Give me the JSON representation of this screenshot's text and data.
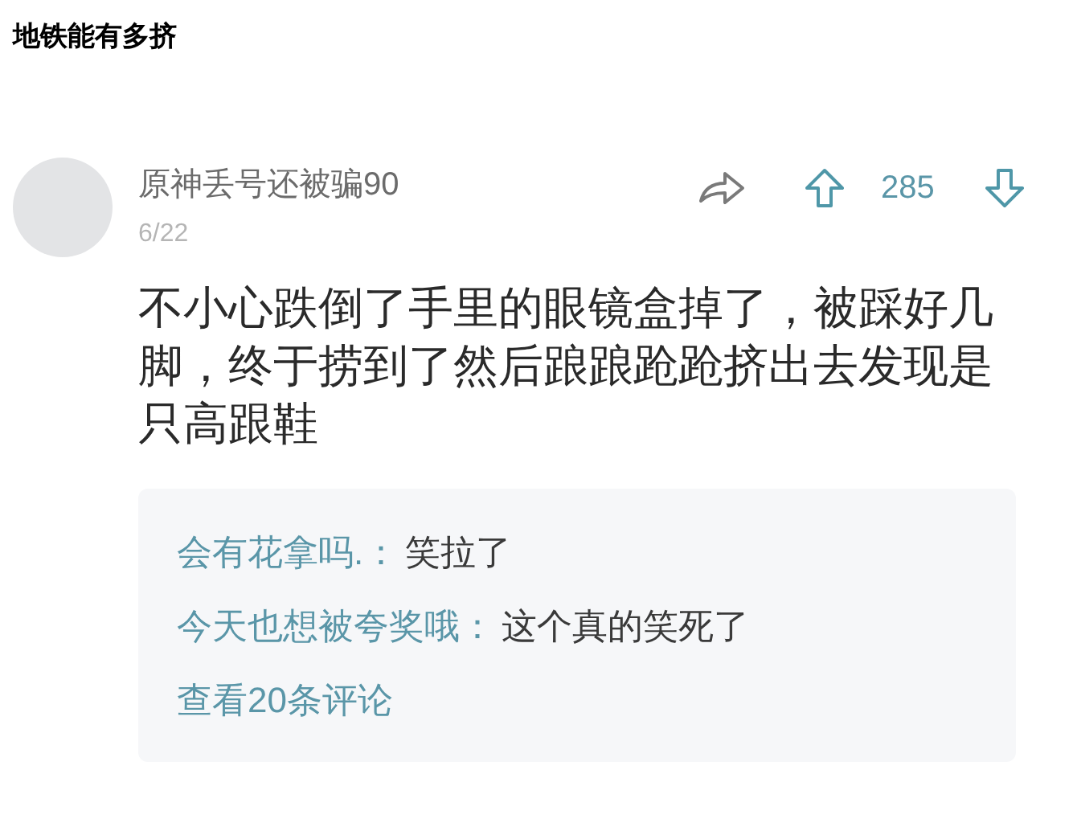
{
  "page_title": "地铁能有多挤",
  "comment": {
    "username": "原神丢号还被骗90",
    "date": "6/22",
    "votes": "285",
    "text": "不小心跌倒了手里的眼镜盒掉了，被踩好几脚，终于捞到了然后踉踉跄跄挤出去发现是只高跟鞋"
  },
  "replies": [
    {
      "name": "会有花拿吗.：",
      "text": "笑拉了"
    },
    {
      "name": "今天也想被夸奖哦：",
      "text": "这个真的笑死了"
    }
  ],
  "more_replies": "查看20条评论"
}
